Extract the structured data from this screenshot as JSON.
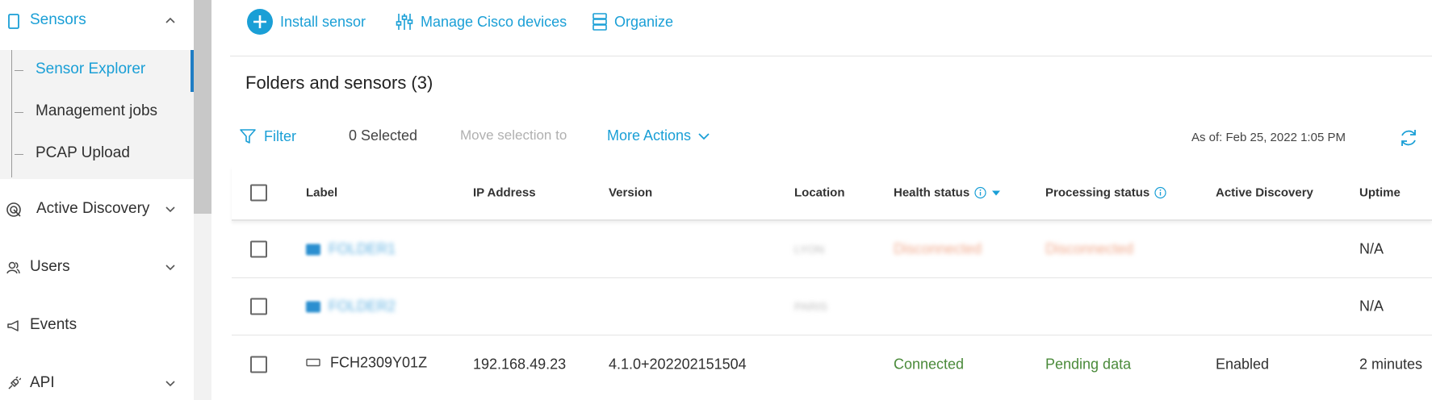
{
  "sidebar": {
    "sensors": {
      "label": "Sensors",
      "icon": "tablet-icon"
    },
    "sub_items": [
      {
        "label": "Sensor Explorer",
        "active": true
      },
      {
        "label": "Management jobs",
        "active": false
      },
      {
        "label": "PCAP Upload",
        "active": false
      }
    ],
    "sections": [
      {
        "label": "Active Discovery",
        "icon": "radar-icon"
      },
      {
        "label": "Users",
        "icon": "users-icon"
      },
      {
        "label": "Events",
        "icon": "megaphone-icon"
      },
      {
        "label": "API",
        "icon": "plug-icon"
      }
    ]
  },
  "toolbar": {
    "install": "Install sensor",
    "manage": "Manage Cisco devices",
    "organize": "Organize"
  },
  "title": "Folders and sensors (3)",
  "actions": {
    "filter": "Filter",
    "selected": "0 Selected",
    "move": "Move selection to",
    "more": "More Actions",
    "as_of": "As of: Feb 25, 2022 1:05 PM"
  },
  "table": {
    "headers": [
      "Label",
      "IP Address",
      "Version",
      "Location",
      "Health status",
      "Processing status",
      "Active Discovery",
      "Uptime"
    ],
    "rows": [
      {
        "label": "FOLDER1",
        "ip": "",
        "version": "",
        "location": "LYON",
        "health": "Disconnected",
        "processing": "Disconnected",
        "active_discovery": "",
        "uptime": "N/A",
        "type": "folder"
      },
      {
        "label": "FOLDER2",
        "ip": "",
        "version": "",
        "location": "PARIS",
        "health": "",
        "processing": "",
        "active_discovery": "",
        "uptime": "N/A",
        "type": "folder"
      },
      {
        "label": "FCH2309Y01Z",
        "ip": "192.168.49.23",
        "version": "4.1.0+202202151504",
        "location": "",
        "health": "Connected",
        "processing": "Pending data",
        "active_discovery": "Enabled",
        "uptime": "2 minutes",
        "type": "sensor"
      }
    ]
  },
  "colors": {
    "accent": "#1a9fd6",
    "status_green": "#4a8a3a",
    "active_bar": "#1f7dc4"
  }
}
